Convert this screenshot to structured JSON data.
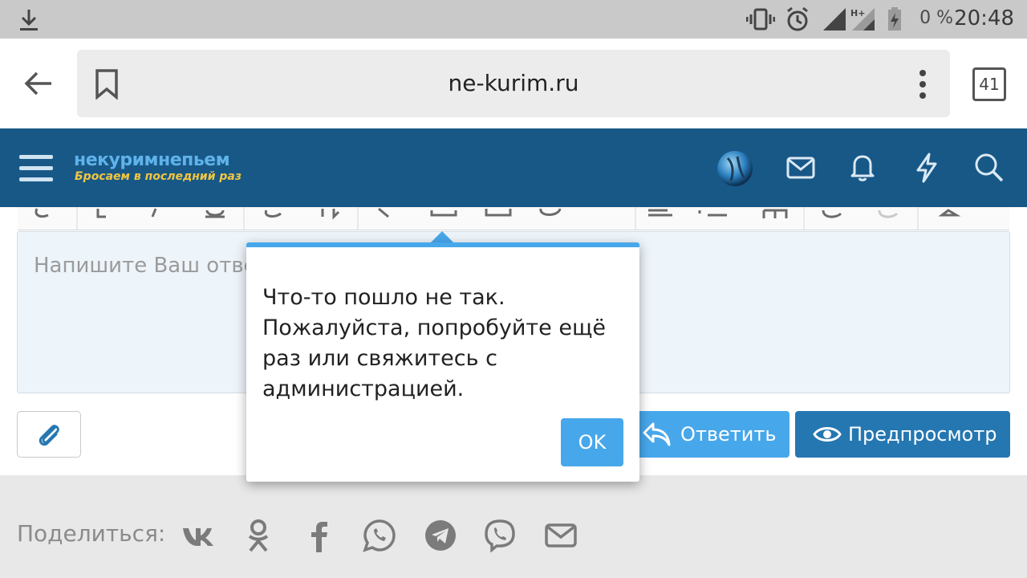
{
  "status_bar": {
    "battery_percent": "0 %",
    "time": "20:48"
  },
  "browser": {
    "url": "ne-kurim.ru",
    "tab_count": "41"
  },
  "site": {
    "logo_title": "некуримнепьем",
    "logo_tagline": "Бросаем в последний раз"
  },
  "editor": {
    "placeholder": "Напишите Ваш ответ..."
  },
  "actions": {
    "reply_label": "Ответить",
    "preview_label": "Предпросмотр"
  },
  "share": {
    "label": "Поделиться:",
    "networks": [
      "vk",
      "odnoklassniki",
      "facebook",
      "whatsapp",
      "telegram",
      "viber",
      "email"
    ]
  },
  "dialog": {
    "message": "Что-то пошло не так. Пожалуйста, попробуйте ещё раз или свяжитесь с администрацией.",
    "ok_label": "OK"
  },
  "colors": {
    "header_bg": "#185887",
    "accent": "#47a7eb",
    "preview_button": "#2577b1",
    "logo_yellow": "#f2c640"
  }
}
